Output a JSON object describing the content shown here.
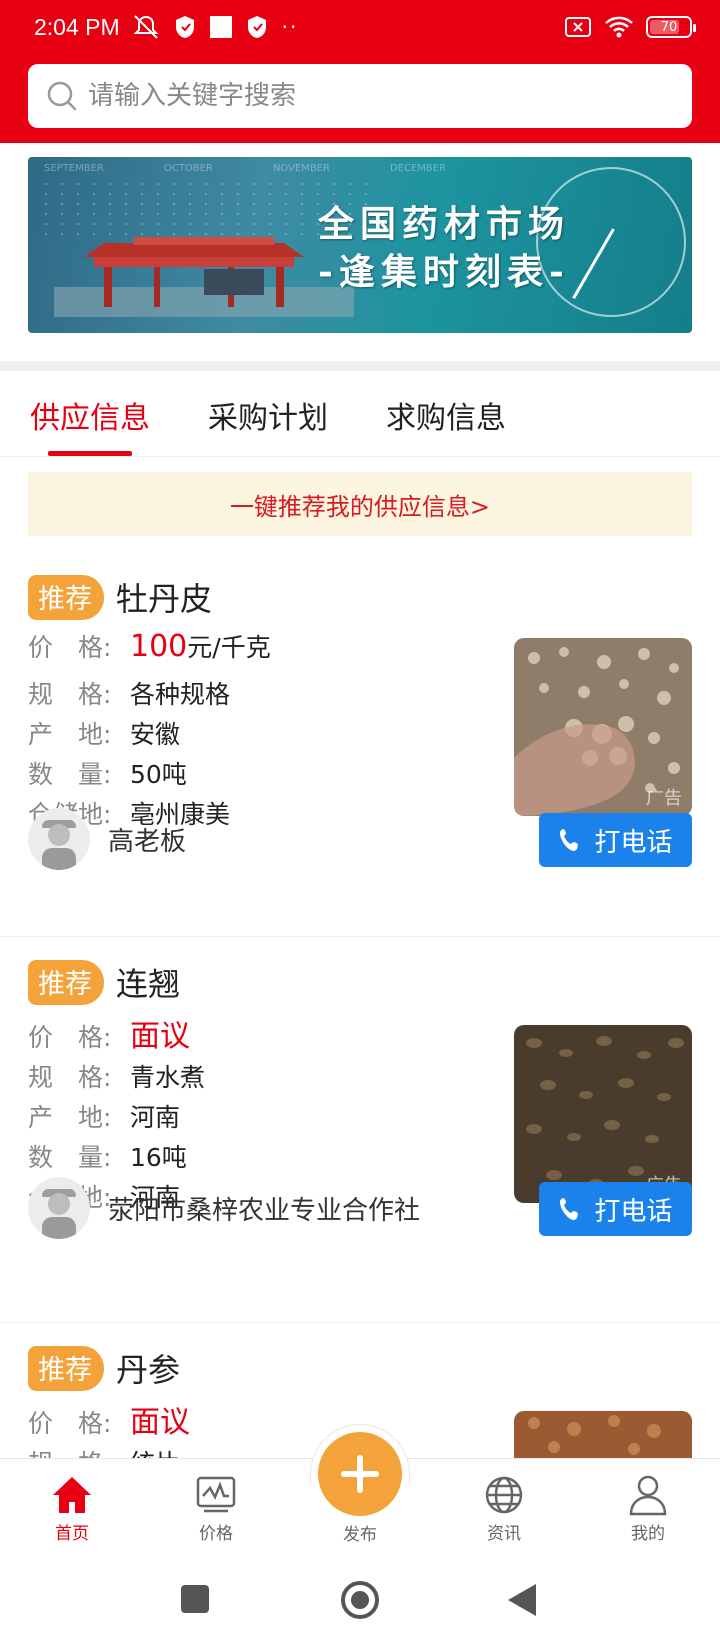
{
  "status": {
    "time": "2:04 PM",
    "battery": "70"
  },
  "search": {
    "placeholder": "请输入关键字搜索"
  },
  "banner": {
    "line1": "全国药材市场",
    "line2": "-逢集时刻表-",
    "months": [
      "SEPTEMBER",
      "OCTOBER",
      "NOVEMBER",
      "DECEMBER"
    ]
  },
  "tabs": [
    {
      "label": "供应信息",
      "active": true
    },
    {
      "label": "采购计划",
      "active": false
    },
    {
      "label": "求购信息",
      "active": false
    }
  ],
  "promo": "一键推荐我的供应信息>",
  "labels": {
    "tag": "推荐",
    "price": "价　格:",
    "spec": "规　格:",
    "origin": "产　地:",
    "qty": "数　量:",
    "storage": "仓储地:",
    "call": "打电话",
    "ad": "广告"
  },
  "listings": [
    {
      "name": "牡丹皮",
      "price_num": "100",
      "price_unit": "元/千克",
      "spec": "各种规格",
      "origin": "安徽",
      "qty": "50吨",
      "storage": "亳州康美",
      "seller": "高老板"
    },
    {
      "name": "连翘",
      "price_num": "面议",
      "price_unit": "",
      "spec": "青水煮",
      "origin": "河南",
      "qty": "16吨",
      "storage": "河南",
      "seller": "荥阳市桑梓农业专业合作社"
    },
    {
      "name": "丹参",
      "price_num": "面议",
      "price_unit": "",
      "spec": "统片"
    }
  ],
  "nav": [
    {
      "label": "首页",
      "icon": "home-icon",
      "active": true
    },
    {
      "label": "价格",
      "icon": "price-chart-icon",
      "active": false
    },
    {
      "label": "发布",
      "icon": "plus-icon",
      "active": false
    },
    {
      "label": "资讯",
      "icon": "globe-icon",
      "active": false
    },
    {
      "label": "我的",
      "icon": "user-icon",
      "active": false
    }
  ],
  "colors": {
    "brand": "#e60012",
    "tag": "#f4a33b",
    "call": "#1c82eb",
    "promo_bg": "#fcf5df"
  }
}
